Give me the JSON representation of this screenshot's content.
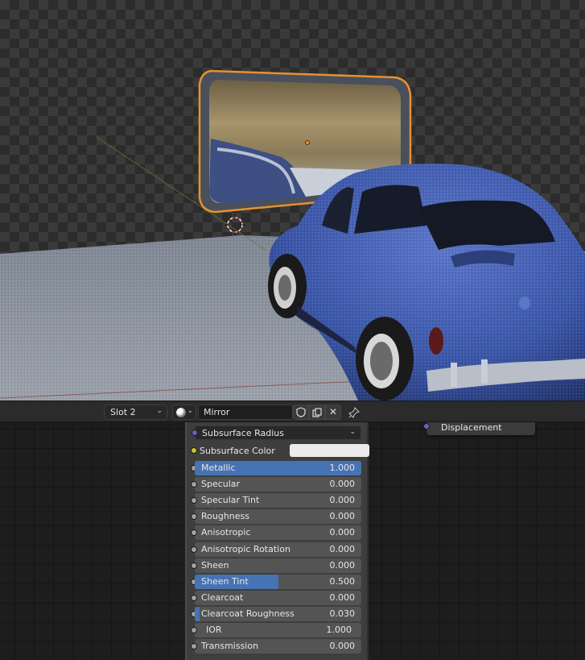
{
  "header": {
    "slot_label": "Slot 2",
    "material_name": "Mirror",
    "icons": [
      "material-ball-icon",
      "chevron-down-icon",
      "fake-user-shield-icon",
      "duplicate-icon",
      "unlink-x-icon",
      "pin-icon"
    ]
  },
  "output_node": {
    "socket_label": "Displacement"
  },
  "bsdf": {
    "subsurface_radius": "Subsurface Radius",
    "subsurface_color": "Subsurface Color",
    "rows": [
      {
        "label": "Metallic",
        "value": "1.000",
        "fill": 1.0
      },
      {
        "label": "Specular",
        "value": "0.000",
        "fill": 0.0
      },
      {
        "label": "Specular Tint",
        "value": "0.000",
        "fill": 0.0
      },
      {
        "label": "Roughness",
        "value": "0.000",
        "fill": 0.0
      },
      {
        "label": "Anisotropic",
        "value": "0.000",
        "fill": 0.0
      },
      {
        "label": "Anisotropic Rotation",
        "value": "0.000",
        "fill": 0.0
      },
      {
        "label": "Sheen",
        "value": "0.000",
        "fill": 0.0
      },
      {
        "label": "Sheen Tint",
        "value": "0.500",
        "fill": 0.5
      },
      {
        "label": "Clearcoat",
        "value": "0.000",
        "fill": 0.0
      },
      {
        "label": "Clearcoat Roughness",
        "value": "0.030",
        "fill": 0.03
      },
      {
        "label": "IOR",
        "value": "1.000",
        "fill": 0.0
      },
      {
        "label": "Transmission",
        "value": "0.000",
        "fill": 0.0
      }
    ]
  },
  "colors": {
    "slider_fill": "#4772b3",
    "selection_outline": "#e8912d",
    "car_body": "#3a56a8"
  }
}
